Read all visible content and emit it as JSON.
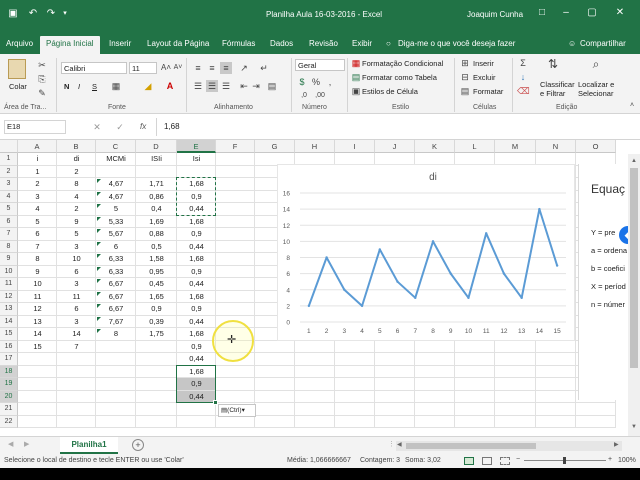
{
  "titlebar": {
    "title": "Planilha Aula 16-03-2016 - Excel",
    "user": "Joaquim Cunha",
    "brand_color": "#217346"
  },
  "tabs": {
    "file": "Arquivo",
    "items": [
      "Página Inicial",
      "Inserir",
      "Layout da Página",
      "Fórmulas",
      "Dados",
      "Revisão",
      "Exibir"
    ],
    "tell_me": "Diga-me o que você deseja fazer",
    "share": "Compartilhar"
  },
  "ribbon": {
    "paste": "Colar",
    "font_name": "Calibri",
    "font_size": "11",
    "bold": "N",
    "italic": "I",
    "underline": "S",
    "number_format": "Geral",
    "cond_format": "Formatação Condicional",
    "format_table": "Formatar como Tabela",
    "cell_styles": "Estilos de Célula",
    "insert": "Inserir",
    "delete": "Excluir",
    "format": "Formatar",
    "sort_filter": "Classificar e Filtrar",
    "find_select": "Localizar e Selecionar",
    "groups": {
      "clipboard": "Área de Tra...",
      "font": "Fonte",
      "alignment": "Alinhamento",
      "number": "Número",
      "styles": "Estilo",
      "cells": "Células",
      "editing": "Edição"
    }
  },
  "formula_bar": {
    "name_box": "E18",
    "fx": "fx",
    "value": "1,68"
  },
  "columns": [
    "A",
    "B",
    "C",
    "D",
    "E",
    "F",
    "G",
    "H",
    "I",
    "J",
    "K",
    "L",
    "M",
    "N",
    "O"
  ],
  "selected_column": "E",
  "rows": [
    "1",
    "2",
    "3",
    "4",
    "5",
    "6",
    "7",
    "8",
    "9",
    "10",
    "11",
    "12",
    "13",
    "14",
    "15",
    "16",
    "17",
    "18",
    "19",
    "20",
    "21",
    "22"
  ],
  "table": {
    "headers": {
      "A": "i",
      "B": "di",
      "C": "MCMi",
      "D": "ISIi",
      "E": "Isi"
    },
    "A": [
      "1",
      "2",
      "3",
      "4",
      "5",
      "6",
      "7",
      "8",
      "9",
      "10",
      "11",
      "12",
      "13",
      "14",
      "15"
    ],
    "B": [
      "2",
      "8",
      "4",
      "2",
      "9",
      "5",
      "3",
      "10",
      "6",
      "3",
      "11",
      "6",
      "3",
      "14",
      "7"
    ],
    "C": [
      "4,67",
      "4,67",
      "5",
      "5,33",
      "5,67",
      "6",
      "6,33",
      "6,33",
      "6,67",
      "6,67",
      "6,67",
      "7,67",
      "8"
    ],
    "D": [
      "1,71",
      "0,86",
      "0,4",
      "1,69",
      "0,88",
      "0,5",
      "1,58",
      "0,95",
      "0,45",
      "1,65",
      "0,9",
      "0,39",
      "1,75"
    ],
    "E": [
      "1,68",
      "0,9",
      "0,44",
      "1,68",
      "0,9",
      "0,44",
      "1,68",
      "0,9",
      "0,44",
      "1,68",
      "0,9",
      "0,44",
      "1,68",
      "0,9",
      "0,44",
      "1,68",
      "0,9",
      "0,44"
    ]
  },
  "paste_options": "(Ctrl)",
  "side_panel": {
    "title": "Equaç",
    "lines": [
      "Y = pre",
      "a = ordena",
      "b = coefici",
      "X = períod",
      "n = númer"
    ]
  },
  "chart_data": {
    "type": "line",
    "title": "di",
    "x": [
      1,
      2,
      3,
      4,
      5,
      6,
      7,
      8,
      9,
      10,
      11,
      12,
      13,
      14,
      15
    ],
    "series": [
      {
        "values": [
          2,
          8,
          4,
          2,
          9,
          5,
          3,
          10,
          6,
          3,
          11,
          6,
          3,
          14,
          7
        ]
      }
    ],
    "ylim": [
      0,
      16
    ],
    "yticks": [
      0,
      2,
      4,
      6,
      8,
      10,
      12,
      14,
      16
    ],
    "grid": true,
    "line_color": "#5b9bd5"
  },
  "sheets": [
    "Planilha1"
  ],
  "status": {
    "message": "Selecione o local de destino e tecle ENTER ou use 'Colar'",
    "average": "Média: 1,066666667",
    "count": "Contagem: 3",
    "sum": "Soma: 3,02",
    "zoom": "100%"
  }
}
